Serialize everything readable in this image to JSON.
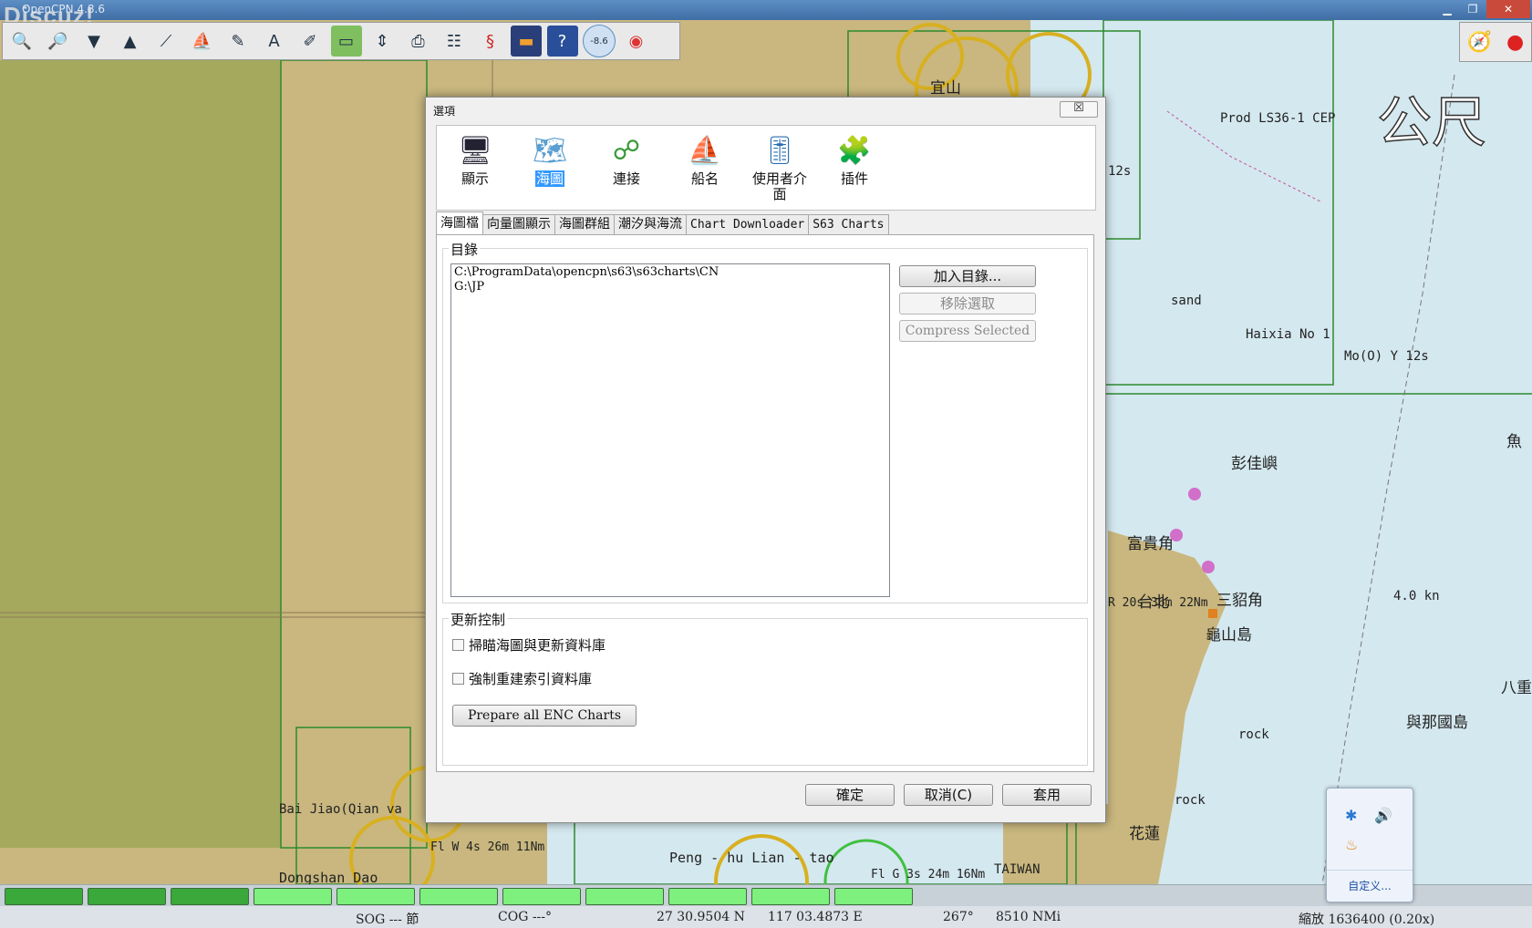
{
  "window": {
    "title": "OpenCPN 4.8.6",
    "watermark": "Discuz!"
  },
  "toolbar": {
    "tools": [
      "zoom-in-icon",
      "zoom-out-icon",
      "scale-down-icon",
      "scale-up-icon",
      "route-icon",
      "ship-icon",
      "tools-icon",
      "text-icon",
      "mark-icon",
      "chart-icon",
      "tide-icon",
      "print-icon",
      "settings-icon",
      "track-icon",
      "depth-icon",
      "help-icon",
      "tide-value-icon",
      "mob-icon"
    ],
    "tide_value": "-8.6"
  },
  "map": {
    "unit_overlay": "公尺",
    "labels": [
      {
        "name": "prod-label",
        "text": "Prod LS36-1 CEP"
      },
      {
        "name": "haixia-label",
        "text": "Haixia No 1"
      },
      {
        "name": "light-label",
        "text": "Mo(O) Y 12s"
      },
      {
        "name": "sand-label",
        "text": "sand"
      },
      {
        "name": "penghu-label",
        "text": "彭佳嶼"
      },
      {
        "name": "fugui-label",
        "text": "富貴角"
      },
      {
        "name": "taipei-label",
        "text": "台北"
      },
      {
        "name": "sanzhao-label",
        "text": "三貂角"
      },
      {
        "name": "guishan-label",
        "text": "龜山島"
      },
      {
        "name": "rock-label",
        "text": "rock"
      },
      {
        "name": "rock2-label",
        "text": "rock"
      },
      {
        "name": "hualian-label",
        "text": "花蓮"
      },
      {
        "name": "yuping-label",
        "text": "與那國島"
      },
      {
        "name": "bajiao-label",
        "text": "Bai Jiao(Qian va"
      },
      {
        "name": "dongshan-label",
        "text": "Dongshan Dao"
      },
      {
        "name": "peng-label",
        "text": "Peng - hu Lian - tao"
      },
      {
        "name": "taiwan-label",
        "text": "TAIWAN"
      },
      {
        "name": "current-label",
        "text": "4.0 kn"
      },
      {
        "name": "light2-label",
        "text": "R 20s 36m 22Nm"
      },
      {
        "name": "light3-label",
        "text": "Fl W 4s 26m 11Nm"
      },
      {
        "name": "light4-label",
        "text": "Fl G 3s 24m 16Nm"
      },
      {
        "name": "yilan-label",
        "text": "宜山"
      },
      {
        "name": "lighthouse-label",
        "text": "12s"
      },
      {
        "name": "bajian-label",
        "text": "八重"
      },
      {
        "name": "yu-label",
        "text": "魚"
      }
    ]
  },
  "dialog": {
    "title": "選項",
    "close_label": "☒",
    "categories": [
      {
        "label": "顯示",
        "icon": "monitor-icon"
      },
      {
        "label": "海圖",
        "icon": "chart-icon"
      },
      {
        "label": "連接",
        "icon": "connection-icon"
      },
      {
        "label": "船名",
        "icon": "ship-icon"
      },
      {
        "label": "使用者介面",
        "icon": "ui-icon"
      },
      {
        "label": "插件",
        "icon": "plugin-icon"
      }
    ],
    "tabs": [
      "海圖檔",
      "向量圖顯示",
      "海圖群組",
      "潮汐與海流",
      "Chart Downloader",
      "S63 Charts"
    ],
    "directories_label": "目錄",
    "directories": [
      "C:\\ProgramData\\opencpn\\s63\\s63charts\\CN",
      "G:\\JP"
    ],
    "add_dir": "加入目錄...",
    "remove_sel": "移除選取",
    "compress_sel": "Compress Selected",
    "update_label": "更新控制",
    "scan_label": "掃瞄海圖與更新資料庫",
    "rebuild_label": "強制重建索引資料庫",
    "prepare_enc": "Prepare all ENC Charts",
    "ok": "確定",
    "cancel": "取消(C)",
    "apply": "套用"
  },
  "status": {
    "sog": "SOG --- 節",
    "cog": "COG ---°",
    "lat": "27 30.9504 N",
    "lon": "117 03.4873 E",
    "bearing": "267°",
    "distance": "8510 NMi",
    "scale": "縮放 1636400 (0.20x)"
  },
  "tray": {
    "customize": "自定义..."
  },
  "colors": {
    "land": "#c9b77f",
    "sea": "#d4e8ef",
    "dialog": "#f0f0f0",
    "select": "#3399ff"
  }
}
